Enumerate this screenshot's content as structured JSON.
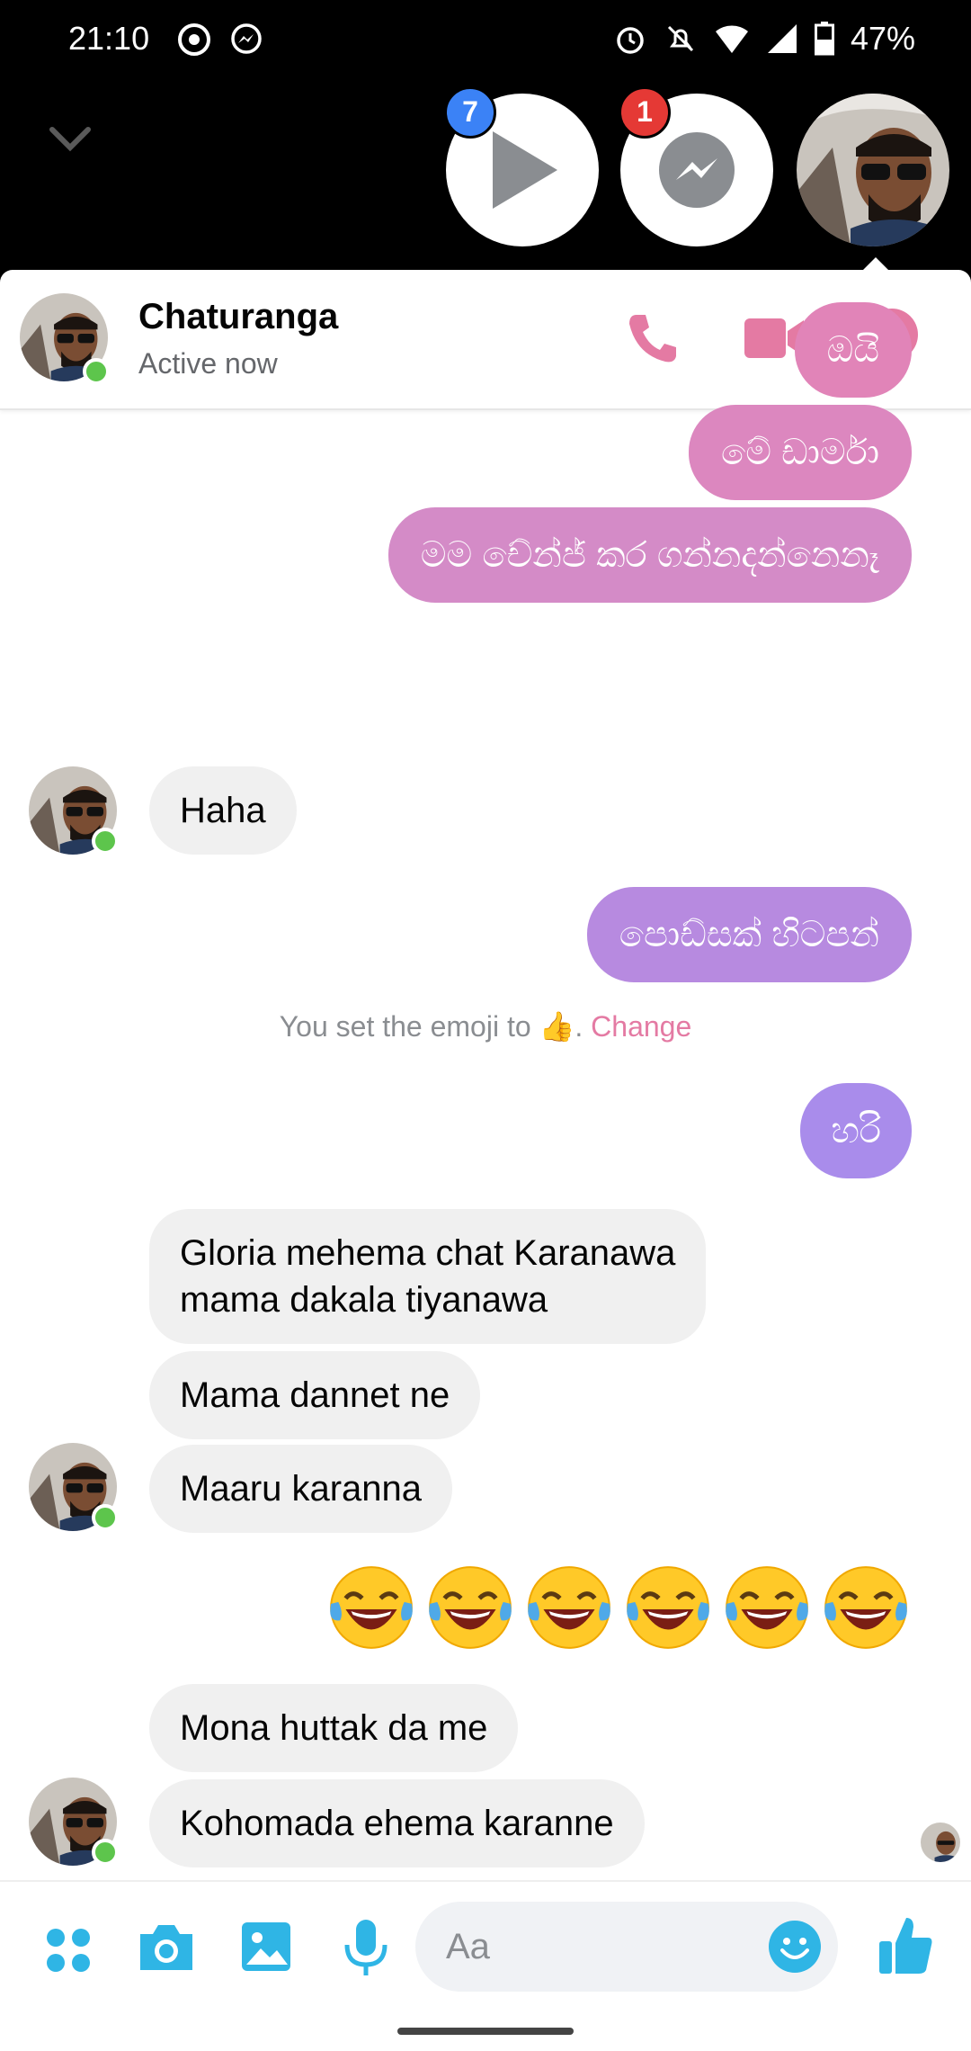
{
  "status": {
    "time": "21:10",
    "battery": "47%"
  },
  "chat_heads": {
    "video_badge": "7",
    "messenger_badge": "1"
  },
  "header": {
    "name": "Chaturanga",
    "status": "Active now"
  },
  "messages": {
    "m1": "ඔයි",
    "m2": "මේ ඩාර්මා",
    "m3": "මම චේන්ජ් කර ගන්නදන්නෙනෑ",
    "m4": "Haha",
    "m5": "පොඩ්සක් හිටපන්",
    "m7": "හරි",
    "m8_line1": "Gloria mehema chat Karanawa",
    "m8_line2": "mama dakala tiyanawa",
    "m9": "Mama dannet ne",
    "m10": "Maaru karanna",
    "m12": "Mona huttak da me",
    "m13": "Kohomada ehema karanne"
  },
  "system": {
    "text": "You set the emoji to",
    "emoji": "👍",
    "sep": ".",
    "link": "Change"
  },
  "emoji_reaction": {
    "icon": "laughing-tears",
    "count": 6
  },
  "composer": {
    "placeholder": "Aa"
  },
  "colors": {
    "accent_pink": "#e47aa3",
    "bubble_pink": "#d48bc7",
    "bubble_purple": "#a98ceb",
    "icon_blue": "#2fb5e5"
  }
}
